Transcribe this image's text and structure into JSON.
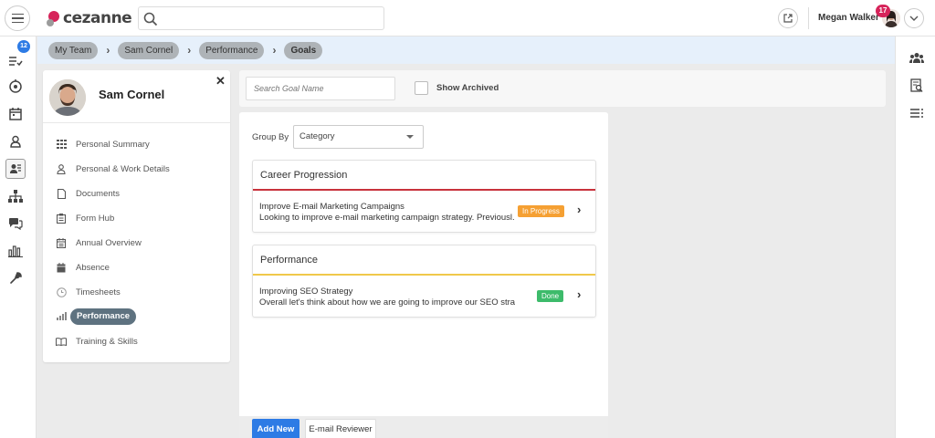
{
  "header": {
    "logo_text": "cezanne",
    "search_placeholder": "",
    "user_name": "Megan Walker",
    "notification_count": "17"
  },
  "leftnav": {
    "badge_count": "12",
    "items": [
      "tasks-icon",
      "timeline-icon",
      "calendar-icon",
      "person-icon",
      "team-icon",
      "org-chart-icon",
      "chat-icon",
      "reports-icon",
      "wrench-icon"
    ]
  },
  "breadcrumb": {
    "items": [
      "My Team",
      "Sam Cornel",
      "Performance",
      "Goals"
    ]
  },
  "profile": {
    "name": "Sam Cornel",
    "close_label": "✕",
    "menu": [
      {
        "label": "Personal Summary",
        "icon": "grid-icon"
      },
      {
        "label": "Personal & Work Details",
        "icon": "person-icon"
      },
      {
        "label": "Documents",
        "icon": "document-icon"
      },
      {
        "label": "Form Hub",
        "icon": "form-icon"
      },
      {
        "label": "Annual Overview",
        "icon": "calendar-icon"
      },
      {
        "label": "Absence",
        "icon": "calendar-x-icon"
      },
      {
        "label": "Timesheets",
        "icon": "clock-icon"
      },
      {
        "label": "Performance",
        "icon": "chart-icon",
        "active": true
      },
      {
        "label": "Training & Skills",
        "icon": "book-icon"
      }
    ]
  },
  "goal_filter": {
    "search_placeholder": "Search Goal Name",
    "show_archived_label": "Show Archived"
  },
  "goals": {
    "group_by_label": "Group By",
    "group_by_value": "Category",
    "groups": [
      {
        "name": "Career Progression",
        "accent": "#c8323c",
        "goals": [
          {
            "title": "Improve E-mail Marketing Campaigns",
            "description": "Looking to improve e-mail marketing campaign strategy. Previousl...",
            "status": "In Progress",
            "status_color": "#f5a033"
          }
        ]
      },
      {
        "name": "Performance",
        "accent": "#f0c84a",
        "goals": [
          {
            "title": "Improving SEO Strategy",
            "description": "Overall let's think about how we are going to improve our SEO stra...",
            "status": "Done",
            "status_color": "#3dbb6b"
          }
        ]
      }
    ],
    "add_button": "Add New",
    "email_button": "E-mail Reviewer"
  },
  "colors": {
    "brand": "#d6245a",
    "primary": "#2d7be5",
    "breadcrumb_bg": "#e6f0fb"
  }
}
